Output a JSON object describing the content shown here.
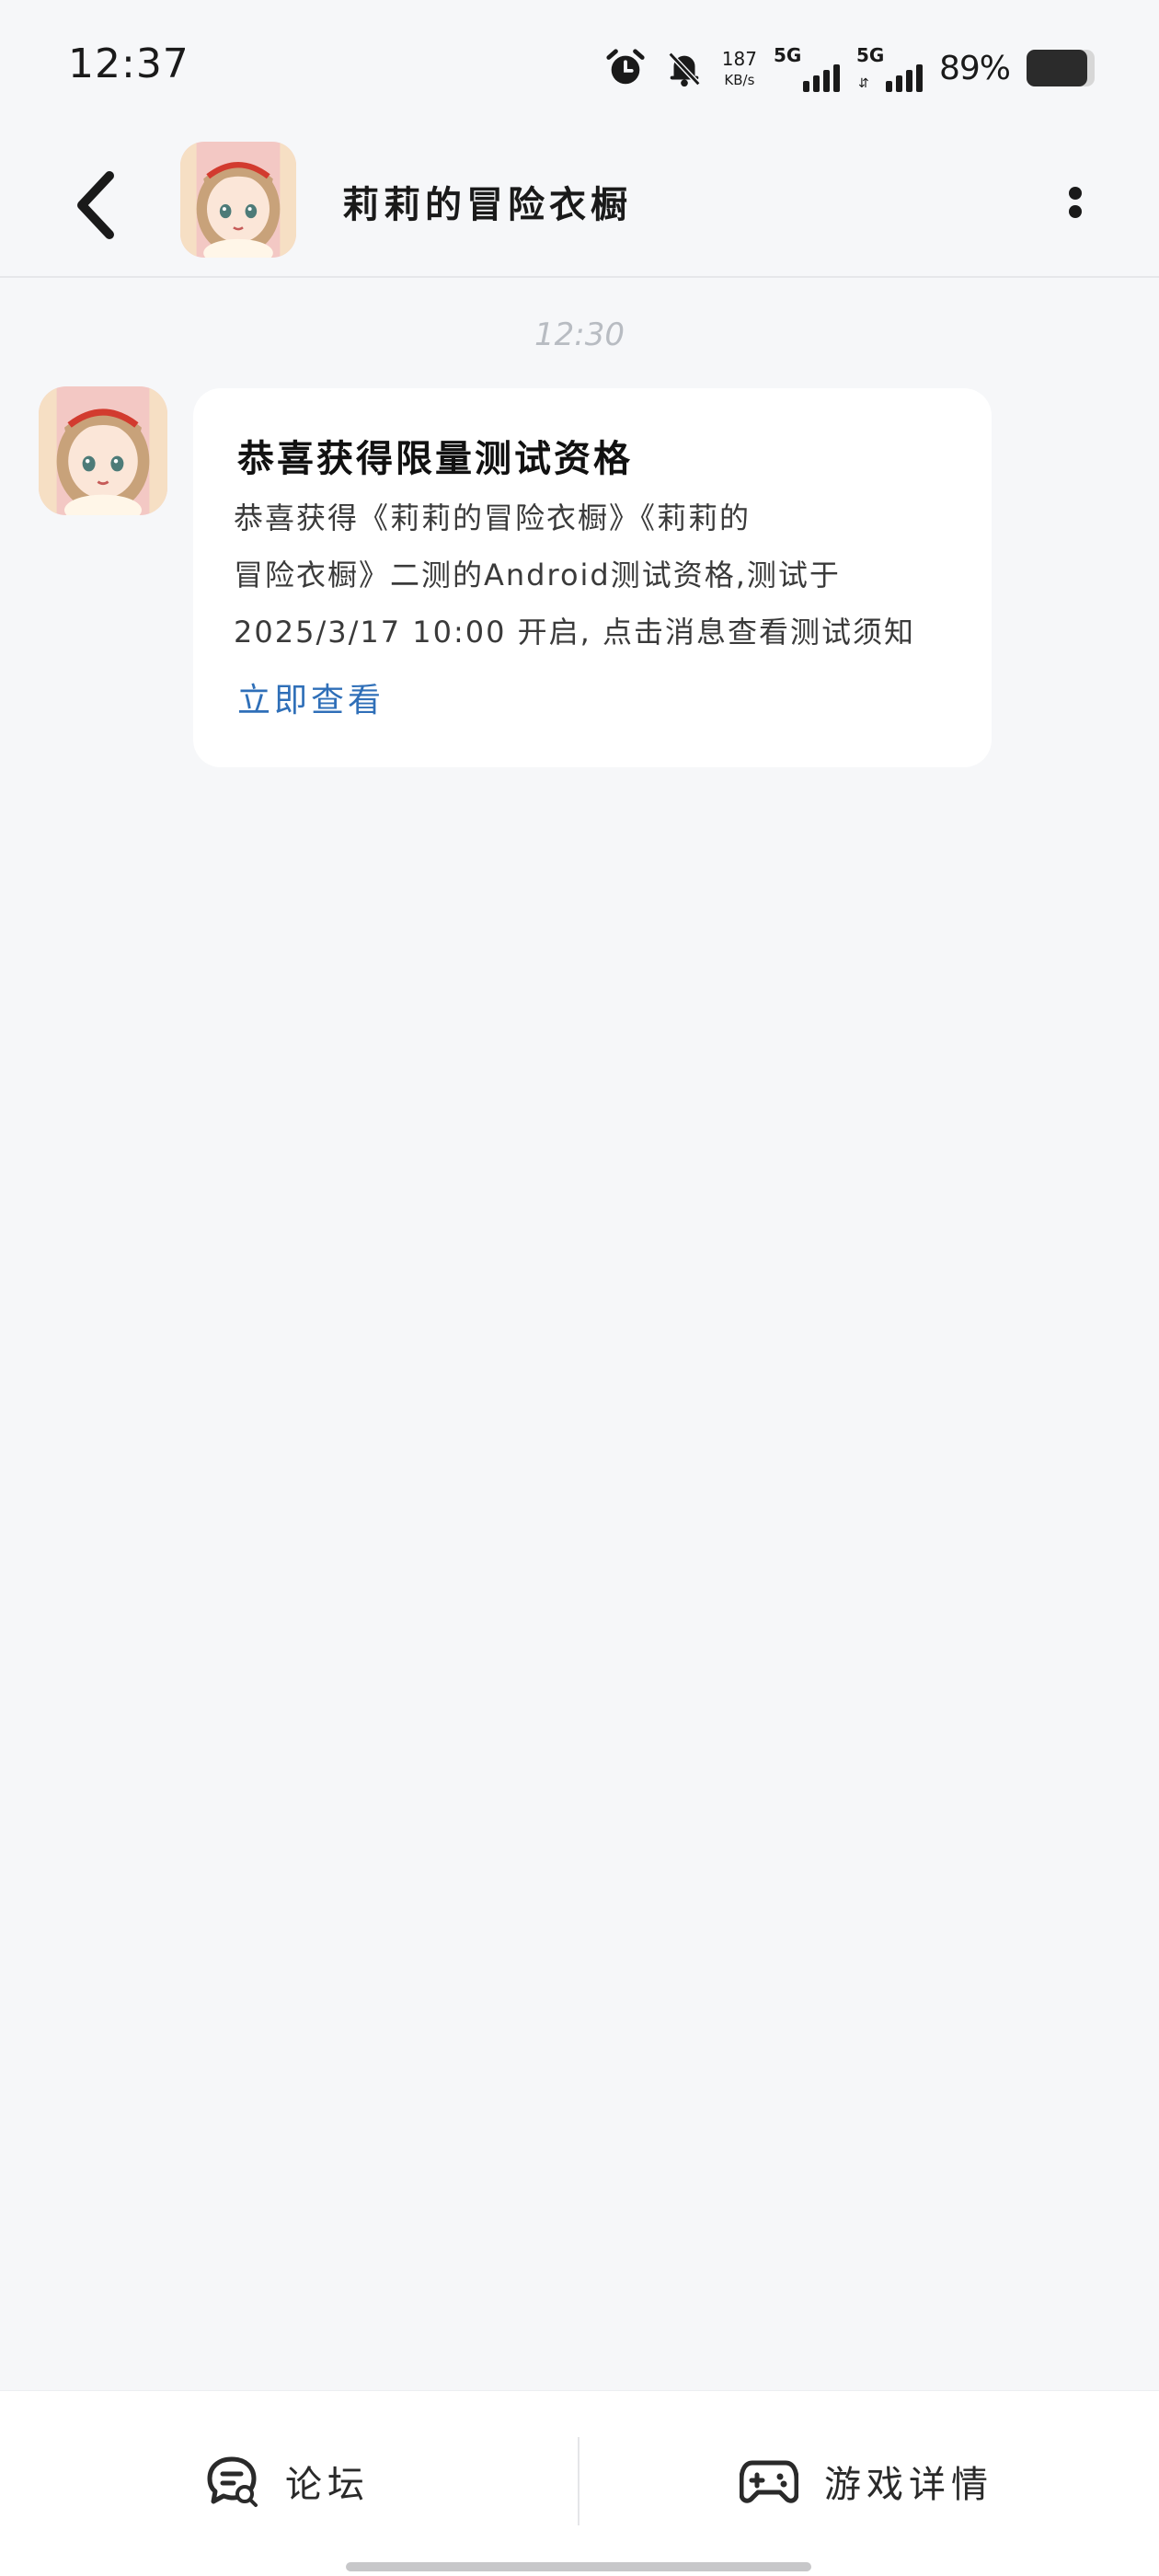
{
  "status_bar": {
    "time": "12:37",
    "icons": [
      "alarm-icon",
      "bell-muted-icon"
    ],
    "net_speed_value": "187",
    "net_speed_unit": "KB/s",
    "signal_1_label": "5G",
    "signal_2_label": "5G",
    "battery_percent": "89%",
    "battery_level": 0.89
  },
  "header": {
    "title": "莉莉的冒险衣橱",
    "back_icon": "back-chevron-icon",
    "more_icon": "more-vertical-icon"
  },
  "chat": {
    "timestamp": "12:30",
    "message": {
      "title": "恭喜获得限量测试资格",
      "body_lines": [
        "恭喜获得《莉莉的冒险衣橱》《莉莉的",
        "冒险衣橱》二测的Android测试资格,测试于",
        "2025/3/17 10:00 开启, 点击消息查看测试须知"
      ],
      "link": "立即查看"
    }
  },
  "bottom_bar": {
    "forum_label": "论坛",
    "forum_icon": "forum-chat-icon",
    "game_label": "游戏详情",
    "game_icon": "gamepad-icon"
  },
  "colors": {
    "background": "#f6f7f9",
    "card": "#ffffff",
    "link": "#2f6fb8",
    "timestamp": "#b8bcc2"
  }
}
